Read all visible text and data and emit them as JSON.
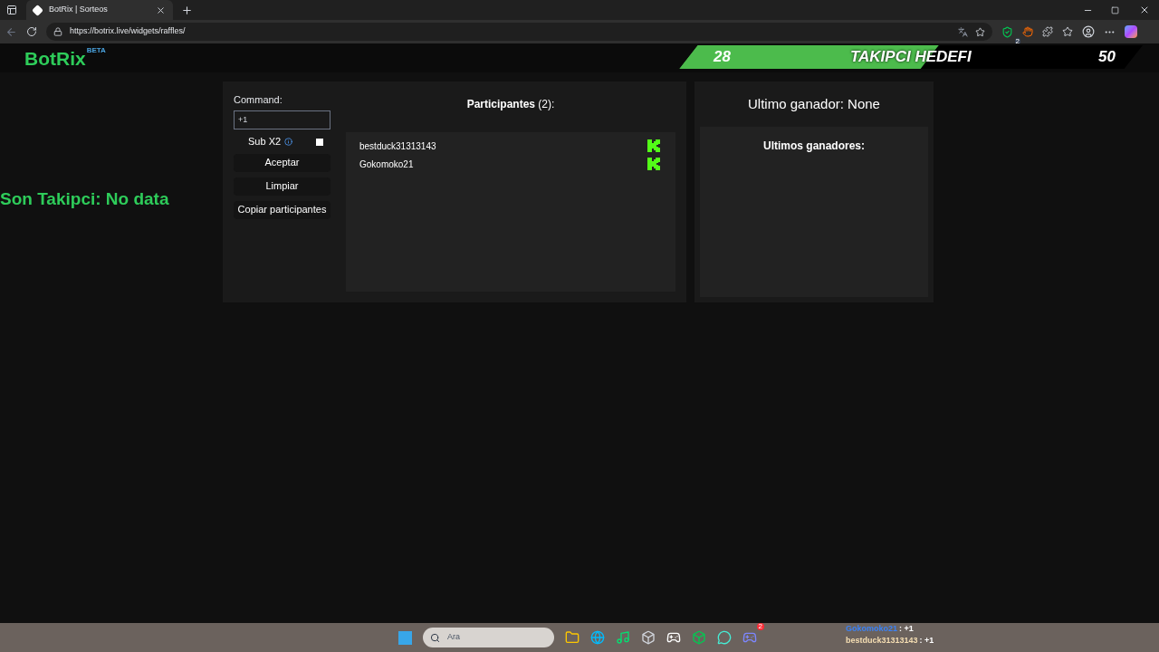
{
  "browser": {
    "tab_title": "BotRix | Sorteos",
    "url": "https://botrix.live/widgets/raffles/",
    "profile_badge": "2"
  },
  "brand": {
    "logo": "BotRix",
    "tag": "BETA"
  },
  "goal": {
    "current": "28",
    "title": "TAKIPCI HEDEFI",
    "target": "50",
    "level": 0.56
  },
  "side_text": "Son Takipci: No data",
  "controls": {
    "command_label": "Command:",
    "command_value": "+1",
    "sub_label": "Sub X2",
    "sub_checked": false,
    "buttons": [
      "Aceptar",
      "Limpiar",
      "Copiar participantes"
    ]
  },
  "participants": {
    "title": "Participantes",
    "count": "(2):",
    "items": [
      {
        "name": "bestduck31313143"
      },
      {
        "name": "Gokomoko21"
      }
    ]
  },
  "winner": {
    "label": "Ultimo ganador:",
    "value": "None",
    "history_title": "Ultimos ganadores:"
  },
  "taskbar": {
    "search_placeholder": "Ara",
    "discord_badge": "2"
  },
  "chat_overlay": [
    {
      "user": "Gokomoko21",
      "message": ": +1",
      "color": "#3b82f6"
    },
    {
      "user": "bestduck31313143",
      "message": ": +1",
      "color": "#f5deb3"
    }
  ]
}
